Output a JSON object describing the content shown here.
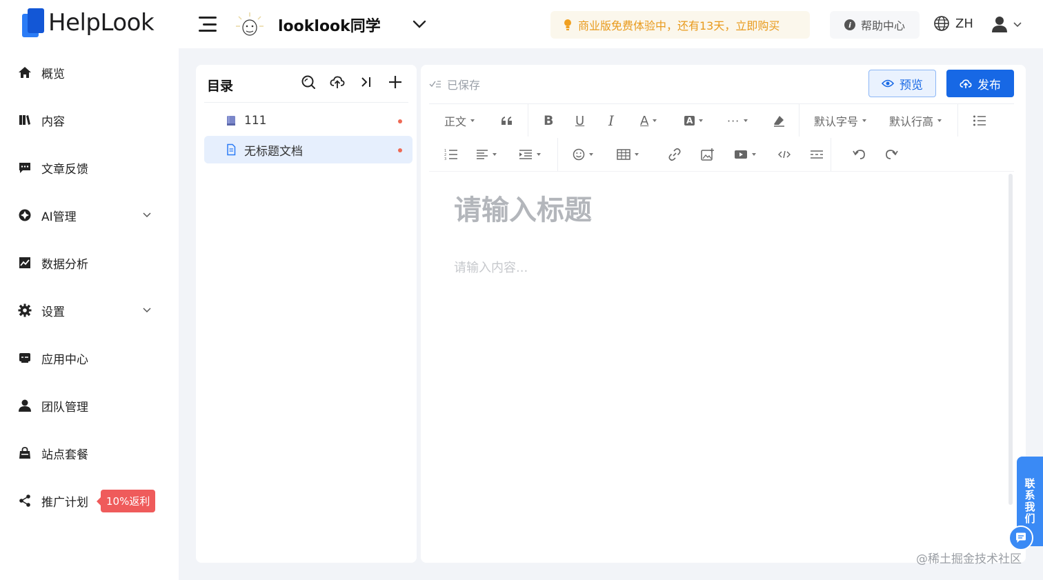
{
  "header": {
    "logo_text": "HelpLook",
    "site_name": "looklook同学",
    "trial_banner": "商业版免费体验中，还有13天，立即购买",
    "help_center": "帮助中心",
    "language": "ZH"
  },
  "sidebar": {
    "items": [
      {
        "label": "概览",
        "icon": "home-icon"
      },
      {
        "label": "内容",
        "icon": "book-icon"
      },
      {
        "label": "文章反馈",
        "icon": "feedback-icon"
      },
      {
        "label": "AI管理",
        "icon": "ai-icon",
        "expandable": true
      },
      {
        "label": "数据分析",
        "icon": "chart-icon"
      },
      {
        "label": "设置",
        "icon": "gear-icon",
        "expandable": true
      },
      {
        "label": "应用中心",
        "icon": "store-icon"
      },
      {
        "label": "团队管理",
        "icon": "user-icon"
      },
      {
        "label": "站点套餐",
        "icon": "bag-icon"
      },
      {
        "label": "推广计划",
        "icon": "share-icon",
        "badge": "10%返利"
      }
    ]
  },
  "toc": {
    "title": "目录",
    "items": [
      {
        "label": "111",
        "icon": "book-icon"
      },
      {
        "label": "无标题文档",
        "icon": "document-icon",
        "active": true
      }
    ]
  },
  "editor": {
    "saved_status": "已保存",
    "preview_label": "预览",
    "publish_label": "发布",
    "toolbar": {
      "paragraph_style": "正文",
      "font_size": "默认字号",
      "line_height": "默认行高"
    },
    "title_placeholder": "请输入标题",
    "content_placeholder": "请输入内容..."
  },
  "floating": {
    "contact_label": "联系我们"
  },
  "watermark": "@稀土掘金技术社区",
  "colors": {
    "brand_blue": "#1768e5",
    "warning_orange": "#e89a1c",
    "badge_red": "#ef5b5b",
    "active_bg": "#e6effd"
  }
}
